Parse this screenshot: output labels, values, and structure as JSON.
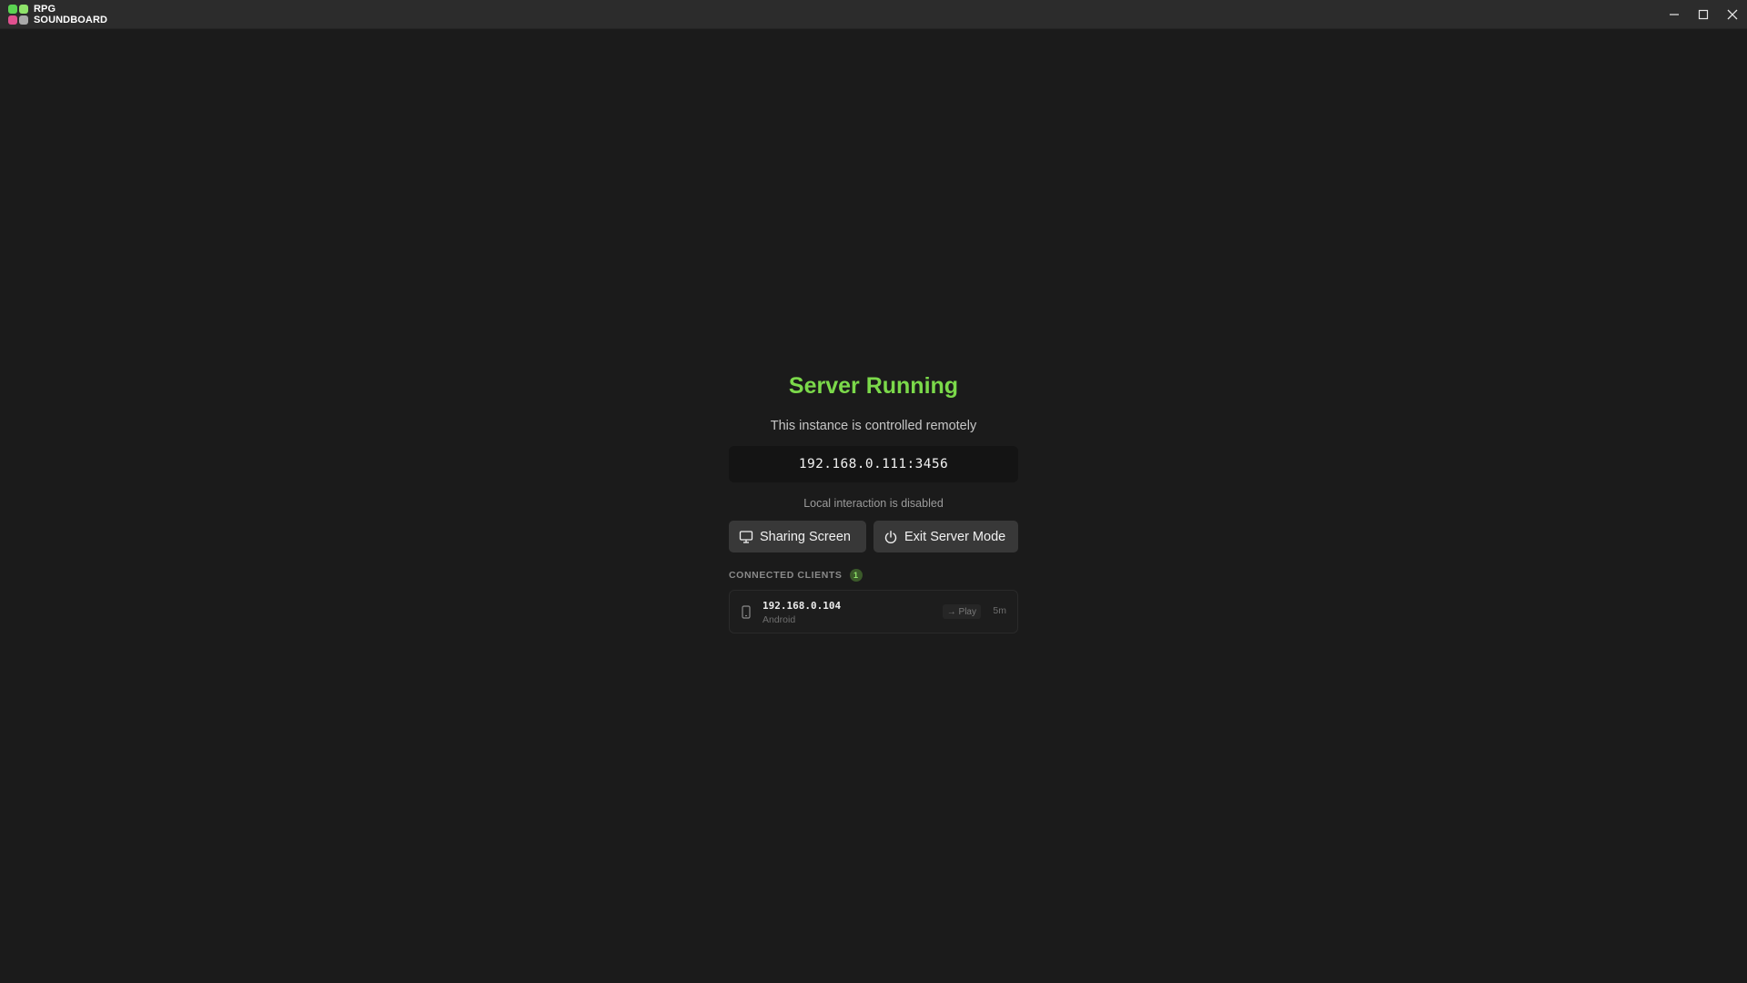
{
  "app": {
    "name_line1": "RPG",
    "name_line2": "SOUNDBOARD"
  },
  "window_controls": {
    "minimize_icon": "minimize-icon",
    "maximize_icon": "maximize-icon",
    "close_icon": "close-icon"
  },
  "server": {
    "title": "Server Running",
    "subtitle": "This instance is controlled remotely",
    "address": "192.168.0.111:3456",
    "note": "Local interaction is disabled"
  },
  "buttons": {
    "share_label": "Sharing Screen",
    "exit_label": "Exit Server Mode"
  },
  "clients": {
    "header": "CONNECTED CLIENTS",
    "count": "1",
    "items": [
      {
        "ip": "192.168.0.104",
        "platform": "Android",
        "view": "→ Play",
        "time": "5m"
      }
    ]
  },
  "colors": {
    "accent": "#7bd94a",
    "background": "#1b1b1b",
    "titlebar": "#2c2c2c"
  }
}
